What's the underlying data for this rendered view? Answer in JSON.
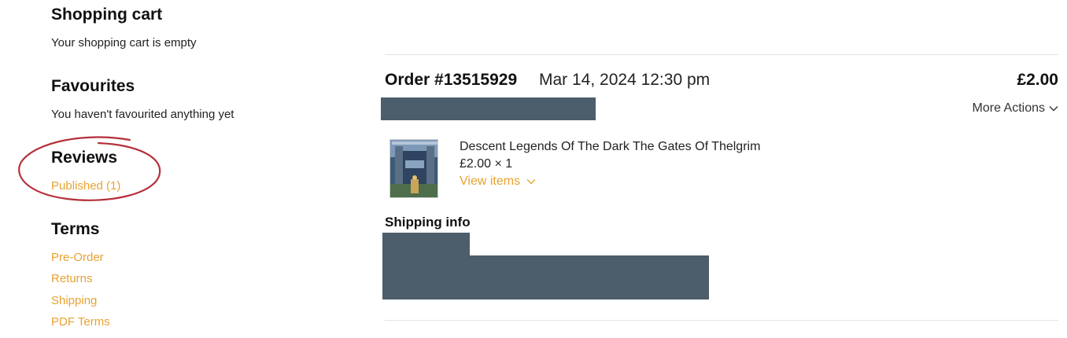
{
  "sidebar": {
    "cart": {
      "title": "Shopping cart",
      "message": "Your shopping cart is empty"
    },
    "favourites": {
      "title": "Favourites",
      "message": "You haven't favourited anything yet"
    },
    "reviews": {
      "title": "Reviews",
      "published_link": "Published (1)"
    },
    "terms": {
      "title": "Terms",
      "links": [
        "Pre-Order",
        "Returns",
        "Shipping",
        "PDF Terms"
      ]
    }
  },
  "order": {
    "id": "Order #13515929",
    "date": "Mar 14, 2024 12:30 pm",
    "total": "£2.00",
    "more_actions_label": "More Actions",
    "item": {
      "title": "Descent Legends Of The Dark The Gates Of Thelgrim",
      "price_qty": "£2.00 × 1",
      "view_items_label": "View items"
    },
    "shipping_title": "Shipping info"
  },
  "colors": {
    "link": "#e8a232",
    "redaction": "#4c5d6b",
    "annotation": "#b5303a"
  }
}
